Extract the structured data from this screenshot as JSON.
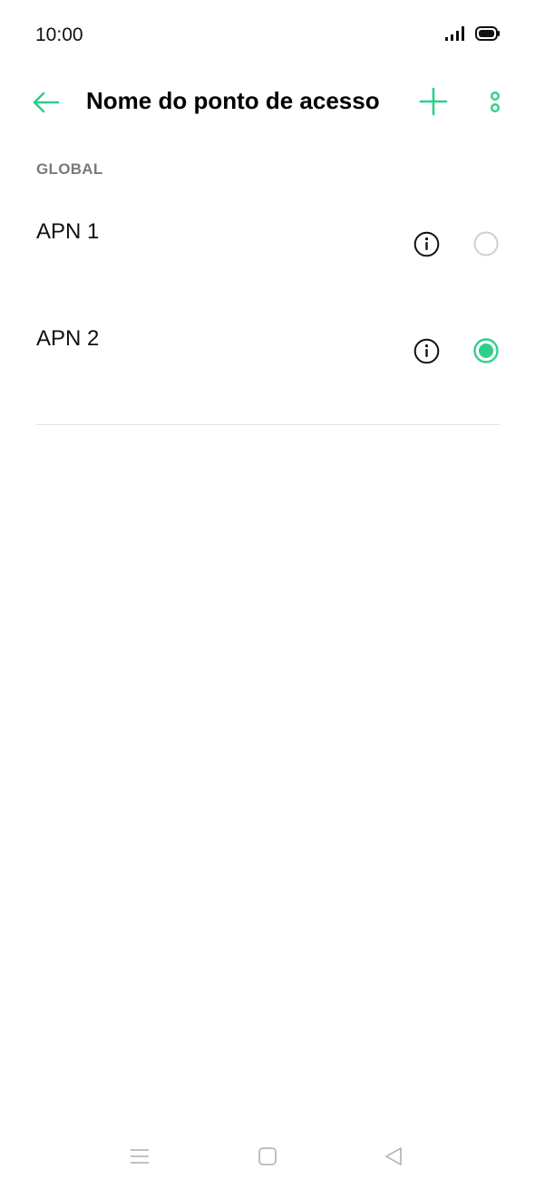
{
  "status_bar": {
    "time": "10:00",
    "icons": [
      "signal-icon",
      "battery-icon"
    ]
  },
  "app_bar": {
    "title": "Nome do ponto de acesso",
    "back_icon": "arrow-left-icon",
    "add_icon": "plus-icon",
    "more_icon": "more-vertical-icon"
  },
  "section": {
    "header": "GLOBAL"
  },
  "apns": [
    {
      "label": "APN 1",
      "selected": false
    },
    {
      "label": "APN 2",
      "selected": true
    }
  ],
  "nav_bar": {
    "icons": [
      "menu-icon",
      "home-icon",
      "back-triangle-icon"
    ]
  },
  "colors": {
    "accent": "#2fcf8a",
    "title": "#000000",
    "section_header": "#7a7a7a",
    "divider": "#e3e3e3",
    "nav_icon": "#b8b8b8"
  }
}
